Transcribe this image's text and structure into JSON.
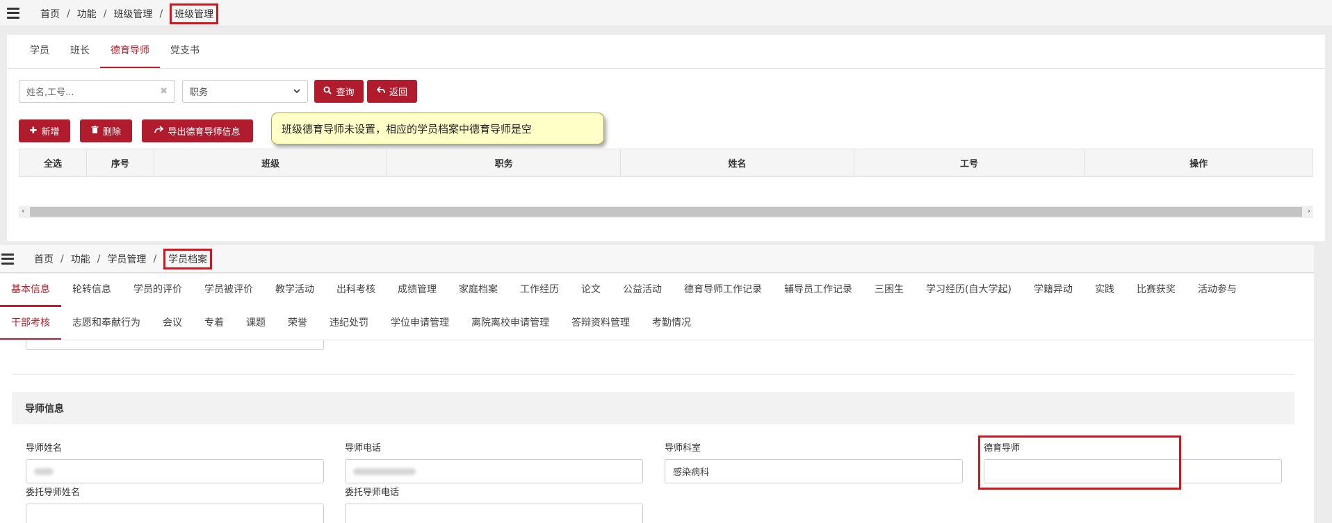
{
  "breadcrumb1": {
    "items": [
      "首页",
      "功能",
      "班级管理"
    ],
    "current": "班级管理"
  },
  "tabs1": [
    "学员",
    "班长",
    "德育导师",
    "党支书"
  ],
  "tabs1_active": "德育导师",
  "search": {
    "placeholder": "姓名,工号..."
  },
  "duty_select": {
    "value": "职务"
  },
  "buttons": {
    "query": "查询",
    "back": "返回",
    "add": "新增",
    "delete": "删除",
    "export": "导出德育导师信息"
  },
  "tooltip": "班级德育导师未设置，相应的学员档案中德育导师是空",
  "table_headers": [
    "全选",
    "序号",
    "班级",
    "职务",
    "姓名",
    "工号",
    "操作"
  ],
  "breadcrumb2": {
    "items": [
      "首页",
      "功能",
      "学员管理"
    ],
    "current": "学员档案"
  },
  "tabs2_row1": [
    "基本信息",
    "轮转信息",
    "学员的评价",
    "学员被评价",
    "教学活动",
    "出科考核",
    "成绩管理",
    "家庭档案",
    "工作经历",
    "论文",
    "公益活动",
    "德育导师工作记录",
    "辅导员工作记录",
    "三困生",
    "学习经历(自大学起)",
    "学籍异动",
    "实践",
    "比赛获奖",
    "活动参与"
  ],
  "tabs2_row2": [
    "干部考核",
    "志愿和奉献行为",
    "会议",
    "专着",
    "课题",
    "荣誉",
    "违纪处罚",
    "学位申请管理",
    "离院离校申请管理",
    "答辩资料管理",
    "考勤情况"
  ],
  "section_title": "导师信息",
  "fields": {
    "tutor_name_label": "导师姓名",
    "tutor_phone_label": "导师电话",
    "tutor_dept_label": "导师科室",
    "tutor_dept_value": "感染病科",
    "moral_tutor_label": "德育导师",
    "moral_tutor_value": "",
    "entrust_name_label": "委托导师姓名",
    "entrust_phone_label": "委托导师电话"
  },
  "colors": {
    "accent": "#b01c2e",
    "highlight": "#d6141b",
    "tooltip_bg": "#ffffc8"
  }
}
